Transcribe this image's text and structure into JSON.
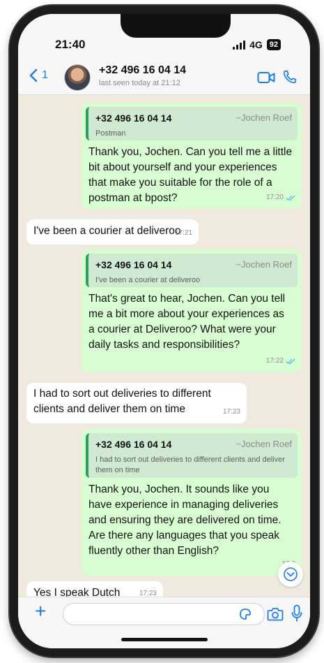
{
  "status": {
    "time": "21:40",
    "network": "4G",
    "battery": "92"
  },
  "header": {
    "back_count": "1",
    "contact_name": "+32 496 16 04 14",
    "last_seen": "last seen today at 21:12"
  },
  "messages": [
    {
      "direction": "out",
      "quote": {
        "number": "+32 496 16 04 14",
        "name": "~Jochen Roef",
        "text": "Postman"
      },
      "text": "Thank you, Jochen. Can you tell me a little bit about yourself and your experiences that make you suitable for the role of a postman at bpost?",
      "time": "17:20"
    },
    {
      "direction": "in",
      "text": "I've been a courier at deliveroo",
      "time": "17:21"
    },
    {
      "direction": "out",
      "quote": {
        "number": "+32 496 16 04 14",
        "name": "~Jochen Roef",
        "text": "I've been a courier at deliveroo"
      },
      "text": "That's great to hear, Jochen. Can you tell me a bit more about your experiences as a courier at Deliveroo? What were your daily tasks and responsibilities?",
      "time": "17:22"
    },
    {
      "direction": "in",
      "text": "I had to sort out deliveries to different clients and deliver them on time",
      "time": "17:23"
    },
    {
      "direction": "out",
      "quote": {
        "number": "+32 496 16 04 14",
        "name": "~Jochen Roef",
        "text": "I had to sort out deliveries to different clients and deliver them on time"
      },
      "text": "Thank you, Jochen. It sounds like you have experience in managing deliveries and ensuring they are delivered on time. Are there any languages that you speak fluently other than English?",
      "time": "17:2"
    },
    {
      "direction": "in",
      "text": "Yes I speak Dutch",
      "time": "17:23"
    }
  ],
  "composer": {
    "value": ""
  },
  "colors": {
    "accent": "#1a7cf2",
    "outgoing": "#d9fdd3",
    "incoming": "#ffffff",
    "quote_bar": "#25a35a"
  }
}
